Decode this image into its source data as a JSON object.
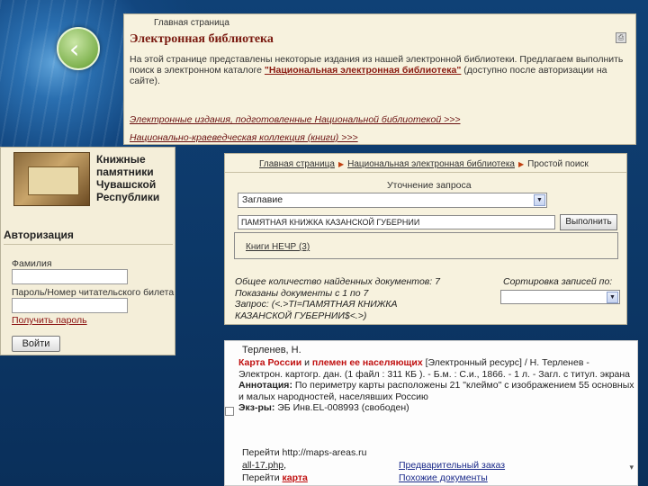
{
  "top_panel": {
    "breadcrumb": "Главная страница",
    "title": "Электронная библиотека",
    "intro_text": "На этой странице представлены некоторые издания из нашей электронной библиотеки. Предлагаем выполнить поиск в электронном каталоге ",
    "intro_link": "\"Национальная электронная библиотека\"",
    "intro_text_end": " (доступно после авторизации на сайте).",
    "link_national": "Электронные издания, подготовленные Национальной библиотекой >>>",
    "link_regional": "Национально-краеведческая коллекция (книги) >>>"
  },
  "left_panel": {
    "collection_title": "Книжные памятники Чувашской Республики",
    "auth_title": "Авторизация",
    "surname_label": "Фамилия",
    "surname_value": "",
    "password_label": "Пароль/Номер читательского билета",
    "password_value": "",
    "get_password_link": "Получить пароль",
    "login_button": "Войти"
  },
  "search_panel": {
    "crumb_home": "Главная страница",
    "crumb_library": "Национальная электронная библиотека",
    "crumb_current": "Простой поиск",
    "refine_label": "Уточнение запроса",
    "field_select_value": "Заглавие",
    "query_value": "ПАМЯТНАЯ КНИЖКА КАЗАНСКОЙ ГУБЕРНИИ",
    "run_button": "Выполнить",
    "facet_link": "Книги НЕЧР (3)",
    "stats_found": "Общее количество найденных документов: 7",
    "stats_shown": "Показаны документы с 1 по 7",
    "stats_query": "Запрос: (<.>TI=ПАМЯТНАЯ КНИЖКА КАЗАНСКОЙ ГУБЕРНИИ$<.>)",
    "sort_label": "Сортировка записей по:",
    "sort_value": ""
  },
  "result_panel": {
    "author": "Терленев, Н.",
    "title_part1": "Карта России",
    "title_and": " и ",
    "title_part2": "племен ее населяющих",
    "resource_type": " [Электронный ресурс] / Н. Терленев",
    "details": " - Электрон. картогр. дан. (1 файл : 311 КБ ). - Б.м. : С.и., 1866. - 1 л. - Загл. с титул. экрана",
    "annotation_label": "Аннотация:",
    "annotation_text": " По периметру карты расположены 21 \"клеймо\" с изображением 55 основных и малых народностей, населявших Россию",
    "copies_label": "Экз-ры:",
    "copies_text": " ЭБ Инв.EL-008993 (свободен)",
    "go_label": "Перейти",
    "url_part1": "http://maps-areas.ru",
    "url_part2": "all-17.php",
    "comma": ",",
    "go_label2": "Перейти",
    "map_link": "карта",
    "order_link": "Предварительный заказ",
    "similar_link": "Похожие документы",
    "scroll_mark": "▾"
  },
  "icons": {
    "nav_back": "chevron-left-icon",
    "print": "print-icon",
    "dropdown": "chevron-down-icon",
    "breadcrumb_arrow": "triangle-right-icon"
  },
  "colors": {
    "background_blue": "#0d3a6b",
    "panel_cream": "#f6f1df",
    "title_red": "#7a1a10",
    "link_red": "#c01010"
  }
}
